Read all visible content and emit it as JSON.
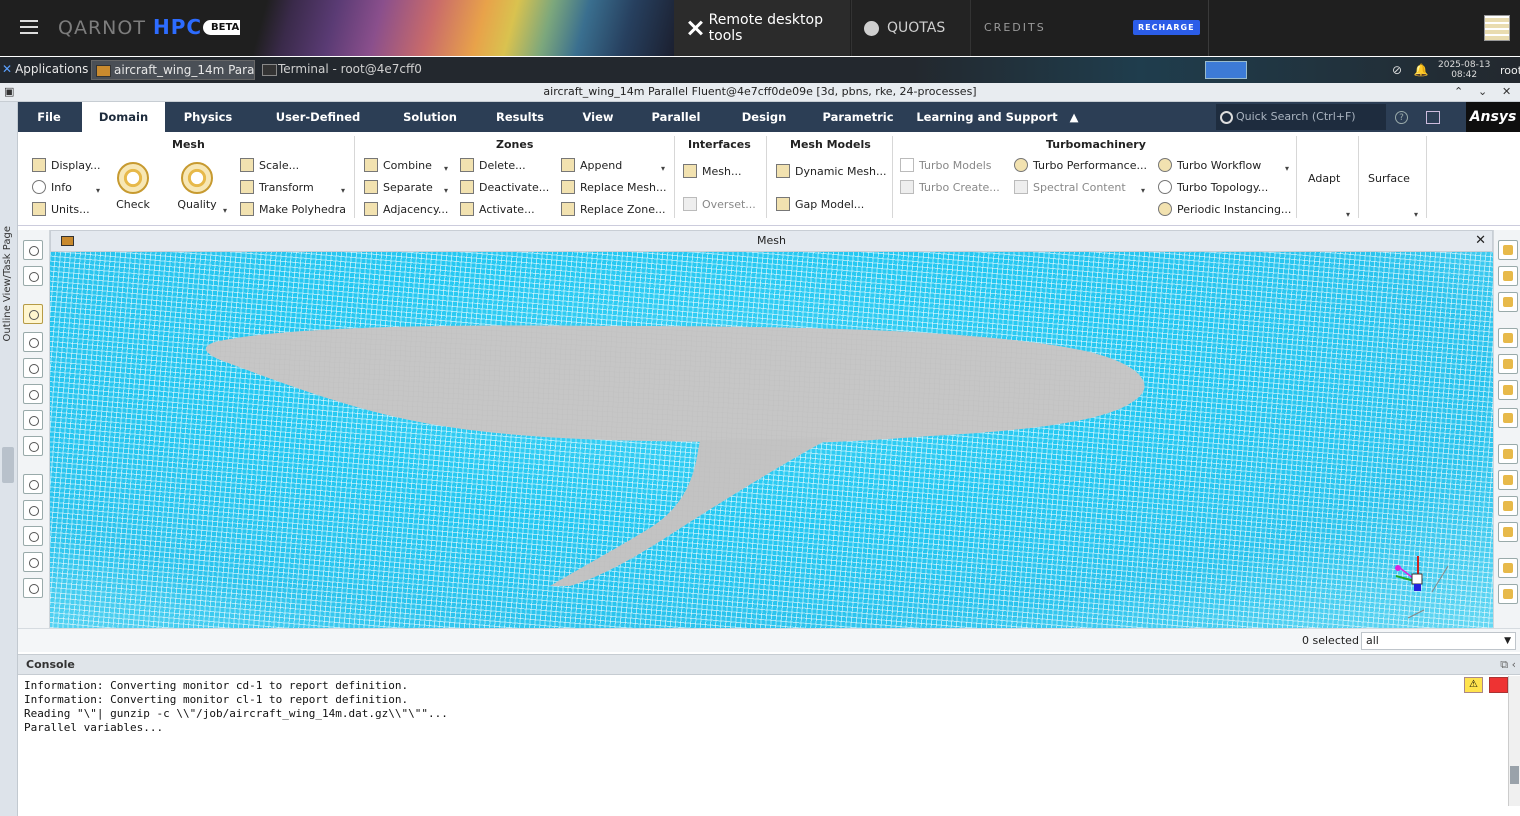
{
  "header": {
    "brand_left": "QARNOT",
    "brand_right": "HPC",
    "beta_badge": "BETA",
    "remote_desktop_tools": "Remote desktop tools",
    "quotas": "QUOTAS",
    "credits": "CREDITS",
    "recharge": "RECHARGE"
  },
  "taskbar": {
    "applications": "Applications",
    "task_fluent": "aircraft_wing_14m Paral...",
    "task_terminal": "Terminal - root@4e7cff0...",
    "date": "2025-08-13",
    "time": "08:42",
    "user": "root"
  },
  "window": {
    "title": "aircraft_wing_14m Parallel Fluent@4e7cff0de09e  [3d, pbns, rke, 24-processes]"
  },
  "menu": {
    "tabs": [
      "File",
      "Domain",
      "Physics",
      "User-Defined",
      "Solution",
      "Results",
      "View",
      "Parallel",
      "Design",
      "Parametric",
      "Learning and Support"
    ],
    "active_tab": "Domain",
    "search_placeholder": "Quick Search (Ctrl+F)",
    "brand": "Ansys"
  },
  "ribbon": {
    "mesh": {
      "title": "Mesh",
      "display": "Display...",
      "info": "Info",
      "units": "Units...",
      "check": "Check",
      "quality": "Quality",
      "scale": "Scale...",
      "transform": "Transform",
      "make_polyhedra": "Make Polyhedra"
    },
    "zones": {
      "title": "Zones",
      "combine": "Combine",
      "separate": "Separate",
      "adjacency": "Adjacency...",
      "delete": "Delete...",
      "deactivate": "Deactivate...",
      "activate": "Activate...",
      "append": "Append",
      "replace_mesh": "Replace Mesh...",
      "replace_zone": "Replace Zone..."
    },
    "interfaces": {
      "title": "Interfaces",
      "mesh": "Mesh...",
      "overset": "Overset..."
    },
    "mesh_models": {
      "title": "Mesh Models",
      "dynamic_mesh": "Dynamic Mesh...",
      "gap_model": "Gap Model..."
    },
    "turbomachinery": {
      "title": "Turbomachinery",
      "turbo_models": "Turbo Models",
      "turbo_create": "Turbo Create...",
      "turbo_performance": "Turbo Performance...",
      "spectral_content": "Spectral Content",
      "turbo_workflow": "Turbo Workflow",
      "turbo_topology": "Turbo Topology...",
      "periodic_instancing": "Periodic Instancing..."
    },
    "adapt": "Adapt",
    "surface": "Surface"
  },
  "sidebar": {
    "label": "Outline View/Task Page"
  },
  "graphics": {
    "title": "Mesh"
  },
  "selection": {
    "count": "0 selected",
    "filter": "all"
  },
  "console": {
    "title": "Console",
    "lines": [
      "Information: Converting monitor cd-1 to report definition.",
      "Information: Converting monitor cl-1 to report definition.",
      "Reading \"\\\"| gunzip -c \\\\\"/job/aircraft_wing_14m.dat.gz\\\\\"\\\"\"...",
      "",
      "",
      "Parallel variables..."
    ]
  },
  "colors": {
    "mesh_cyan": "#24c8f2",
    "surface_gray": "#c6c6c6",
    "tab_bar": "#2c3e55",
    "recharge_blue": "#2b5de8"
  }
}
